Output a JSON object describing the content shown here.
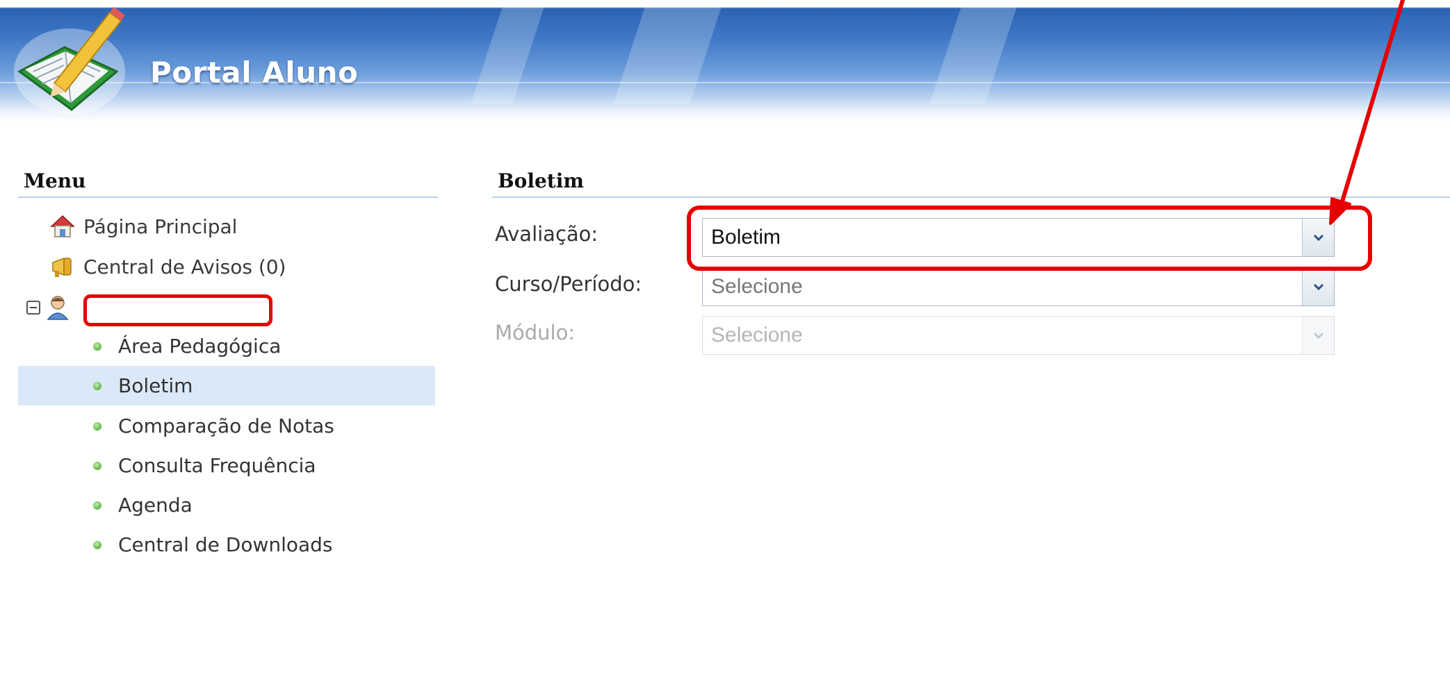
{
  "header": {
    "title": "Portal Aluno"
  },
  "sidebar": {
    "heading": "Menu",
    "top_items": [
      {
        "label": "Página Principal",
        "icon": "home-icon"
      },
      {
        "label": "Central de Avisos (0)",
        "icon": "megaphone-icon"
      }
    ],
    "user": {
      "icon": "user-icon",
      "name": ""
    },
    "sub_items": [
      {
        "label": "Área Pedagógica"
      },
      {
        "label": "Boletim",
        "active": true
      },
      {
        "label": "Comparação de Notas"
      },
      {
        "label": "Consulta Frequência"
      },
      {
        "label": "Agenda"
      },
      {
        "label": "Central de Downloads"
      }
    ]
  },
  "main": {
    "heading": "Boletim",
    "fields": [
      {
        "label": "Avaliação:",
        "value": "Boletim",
        "disabled": false
      },
      {
        "label": "Curso/Período:",
        "value": "Selecione",
        "disabled": false
      },
      {
        "label": "Módulo:",
        "value": "Selecione",
        "disabled": true
      }
    ]
  },
  "colors": {
    "accent": "#2a63b4",
    "annotation": "#e60000",
    "active_bg": "#dbe8f8"
  }
}
